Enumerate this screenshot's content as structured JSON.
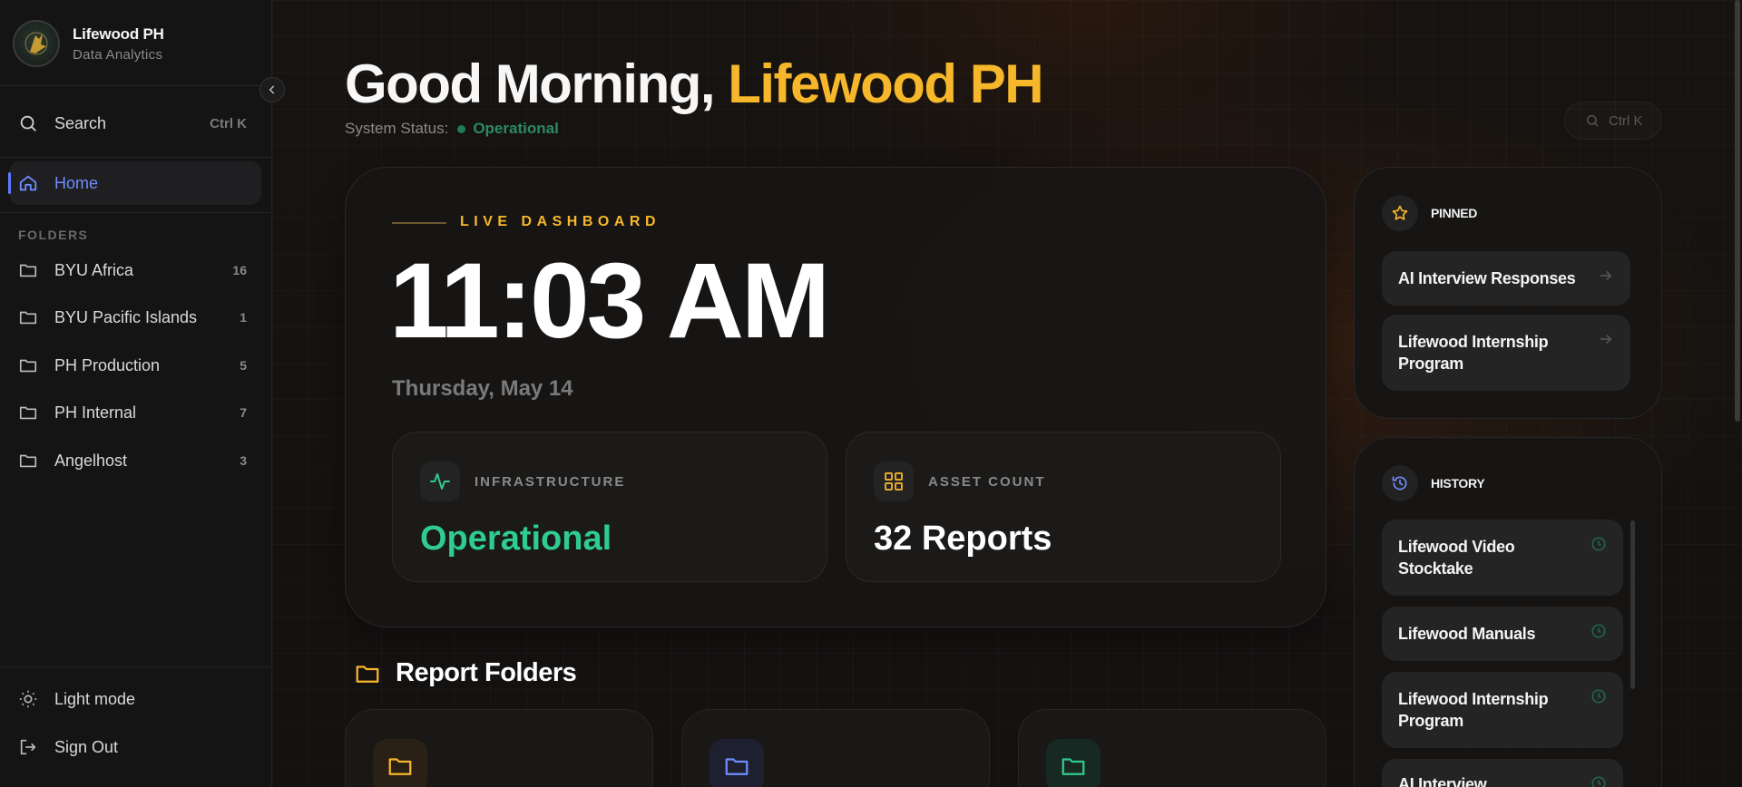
{
  "brand": {
    "name": "Lifewood PH",
    "subtitle": "Data Analytics"
  },
  "sidebar": {
    "search": {
      "label": "Search",
      "shortcut": "Ctrl K"
    },
    "home": {
      "label": "Home"
    },
    "folders_heading": "FOLDERS",
    "folders": [
      {
        "label": "BYU Africa",
        "count": "16"
      },
      {
        "label": "BYU Pacific Islands",
        "count": "1"
      },
      {
        "label": "PH Production",
        "count": "5"
      },
      {
        "label": "PH Internal",
        "count": "7"
      },
      {
        "label": "Angelhost",
        "count": "3"
      }
    ],
    "light_mode": "Light mode",
    "sign_out": "Sign Out"
  },
  "header": {
    "greeting": "Good Morning,",
    "name": "Lifewood PH",
    "status_label": "System Status:",
    "status_value": "Operational",
    "search_shortcut": "Ctrl K"
  },
  "dashboard": {
    "label": "LIVE DASHBOARD",
    "time": "11:03 AM",
    "date": "Thursday, May 14",
    "infrastructure": {
      "label": "INFRASTRUCTURE",
      "value": "Operational"
    },
    "assets": {
      "label": "ASSET COUNT",
      "value": "32 Reports"
    }
  },
  "report_folders": {
    "title": "Report Folders"
  },
  "pinned": {
    "title": "PINNED",
    "items": [
      "AI Interview Responses",
      "Lifewood Internship Program"
    ]
  },
  "history": {
    "title": "HISTORY",
    "items": [
      "Lifewood Video Stocktake",
      "Lifewood Manuals",
      "Lifewood Internship Program",
      "AI Interview Responses"
    ]
  },
  "colors": {
    "accent": "#f6b72a",
    "active_nav": "#6f8cff",
    "success": "#2ecc8f",
    "background": "#121212"
  }
}
